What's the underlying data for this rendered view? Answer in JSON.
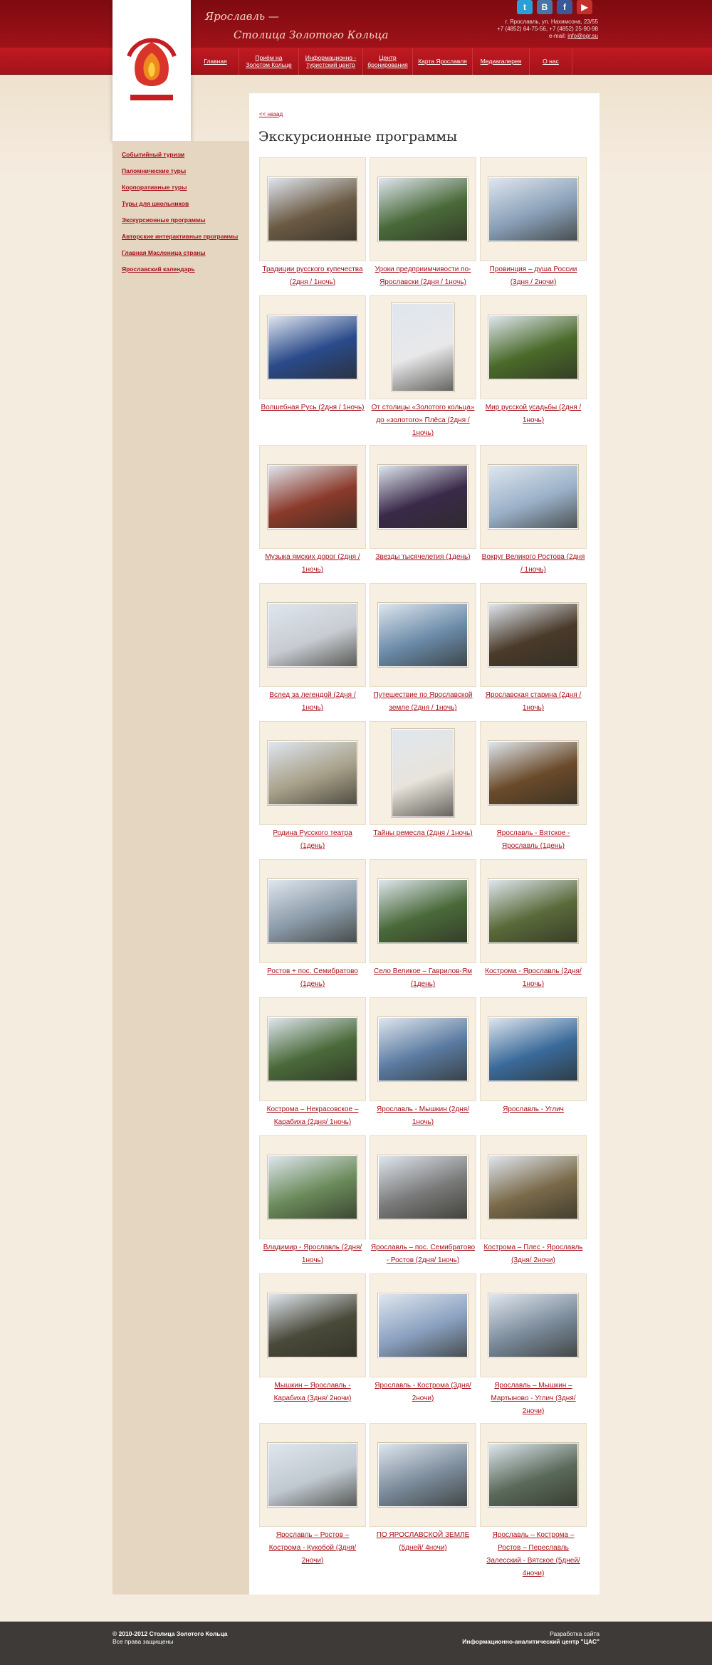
{
  "header": {
    "slogan_line1": "Ярославль —",
    "slogan_line2": "Столица Золотого Кольца",
    "logo_text": "Столица Золотого Кольца",
    "logo_city": "Ярославль",
    "social": [
      {
        "icon": "twitter-icon",
        "glyph": "t",
        "color": "#2aa0d8"
      },
      {
        "icon": "vkontakte-icon",
        "glyph": "B",
        "color": "#4a74a5"
      },
      {
        "icon": "facebook-icon",
        "glyph": "f",
        "color": "#3b5998"
      },
      {
        "icon": "youtube-icon",
        "glyph": "▶",
        "color": "#c4302b"
      }
    ],
    "contact": {
      "address": "г. Ярославль, ул. Нахимсона, 23/55",
      "phones": "+7 (4852) 64-75-56, +7 (4852) 25-90-98",
      "email_label": "e-mail:",
      "email": "info@ogr.su"
    }
  },
  "nav": [
    "Главная",
    "Приём на Золотом Кольце",
    "Информационно - туристский центр",
    "Центр бронирования",
    "Карта Ярославля",
    "Медиагалерея",
    "О нас"
  ],
  "sidebar": [
    "Событийный туризм",
    "Паломнические туры",
    "Корпоративные туры",
    "Туры для школьников",
    "Экскурсионные программы",
    "Авторские интерактивные программы",
    "Главная Масленица страны",
    "Ярославский календарь"
  ],
  "content": {
    "back": "<< назад",
    "title": "Экскурсионные программы"
  },
  "programs": [
    [
      "Традиции русского купечества (2дня / 1ночь)",
      "Уроки предприимчивости по-Ярославски (2дня / 1ночь)",
      "Провинция – душа России (3дня / 2ночи)"
    ],
    [
      "Волшебная Русь (2дня / 1ночь)",
      "От столицы «Золотого кольца» до «золотого» Плёса (2дня / 1ночь)",
      "Мир русской усадьбы (2дня / 1ночь)"
    ],
    [
      "Музыка ямских дорог (2дня / 1ночь)",
      "Звезды тысячелетия (1день)",
      "Вокруг Великого Ростова (2дня / 1ночь)"
    ],
    [
      "Вслед за легендой (2дня / 1ночь)",
      "Путешествие по Ярославской земле (2дня / 1ночь)",
      "Ярославская старина (2дня / 1ночь)"
    ],
    [
      "Родина Русского театра (1день)",
      "Тайны ремесла (2дня / 1ночь)",
      "Ярославль - Вятское - Ярославль (1день)"
    ],
    [
      "Ростов + пос. Семибратово (1день)",
      "Село Великое – Гаврилов-Ям (1день)",
      "Кострома - Ярославль (2дня/ 1ночь)"
    ],
    [
      "Кострома – Некрасовское – Карабиха (2дня/ 1ночь)",
      "Ярославль - Мышкин (2дня/ 1ночь)",
      "Ярославль - Углич"
    ],
    [
      "Владимир - Ярославль (2дня/ 1ночь)",
      "Ярославль – пос. Семибратово - Ростов (2дня/ 1ночь)",
      "Кострома – Плес - Ярославль (3дня/ 2ночи)"
    ],
    [
      "Мышкин – Ярославль - Карабиха (3дня/ 2ночи)",
      "Ярославль - Кострома (3дня/ 2ночи)",
      "Ярославль – Мышкин – Мартыново - Углич (3дня/ 2ночи)"
    ],
    [
      "Ярославль – Ростов – Кострома - Кукобой (3дня/ 2ночи)",
      "ПО ЯРОСЛАВСКОЙ ЗЕМЛЕ (5дней/ 4ночи)",
      "Ярославль – Кострома – Ростов – Переславль Залесский - Вятское (5дней/ 4ночи)"
    ]
  ],
  "photo_colors": [
    [
      "#6b5a44",
      "#4a6a3a",
      "#8aa0b8"
    ],
    [
      "#2a4a8a",
      "#e8e8ea",
      "#4a6a2a"
    ],
    [
      "#8a3a2a",
      "#3a2a4a",
      "#9ab0c8"
    ],
    [
      "#c8ccd2",
      "#6a8aa8",
      "#4a3a2a"
    ],
    [
      "#a8a08a",
      "#e8e4dc",
      "#6a4a2a"
    ],
    [
      "#8a9aa8",
      "#4a6a3a",
      "#5a6a3a"
    ],
    [
      "#4a6a3a",
      "#5a7aa0",
      "#3a6a9a"
    ],
    [
      "#6a8a5a",
      "#7a7a7a",
      "#7a6a4a"
    ],
    [
      "#4a4a3a",
      "#8aa0c0",
      "#7a8a9a"
    ],
    [
      "#c0c8d0",
      "#7a8a9a",
      "#5a6a5a"
    ]
  ],
  "footer": {
    "copyright": "© 2010-2012 Столица Золотого Кольца",
    "rights": "Все права защищены",
    "dev_label": "Разработка сайта",
    "dev_name": "Информационно-аналитический центр \"ЦАС\""
  }
}
